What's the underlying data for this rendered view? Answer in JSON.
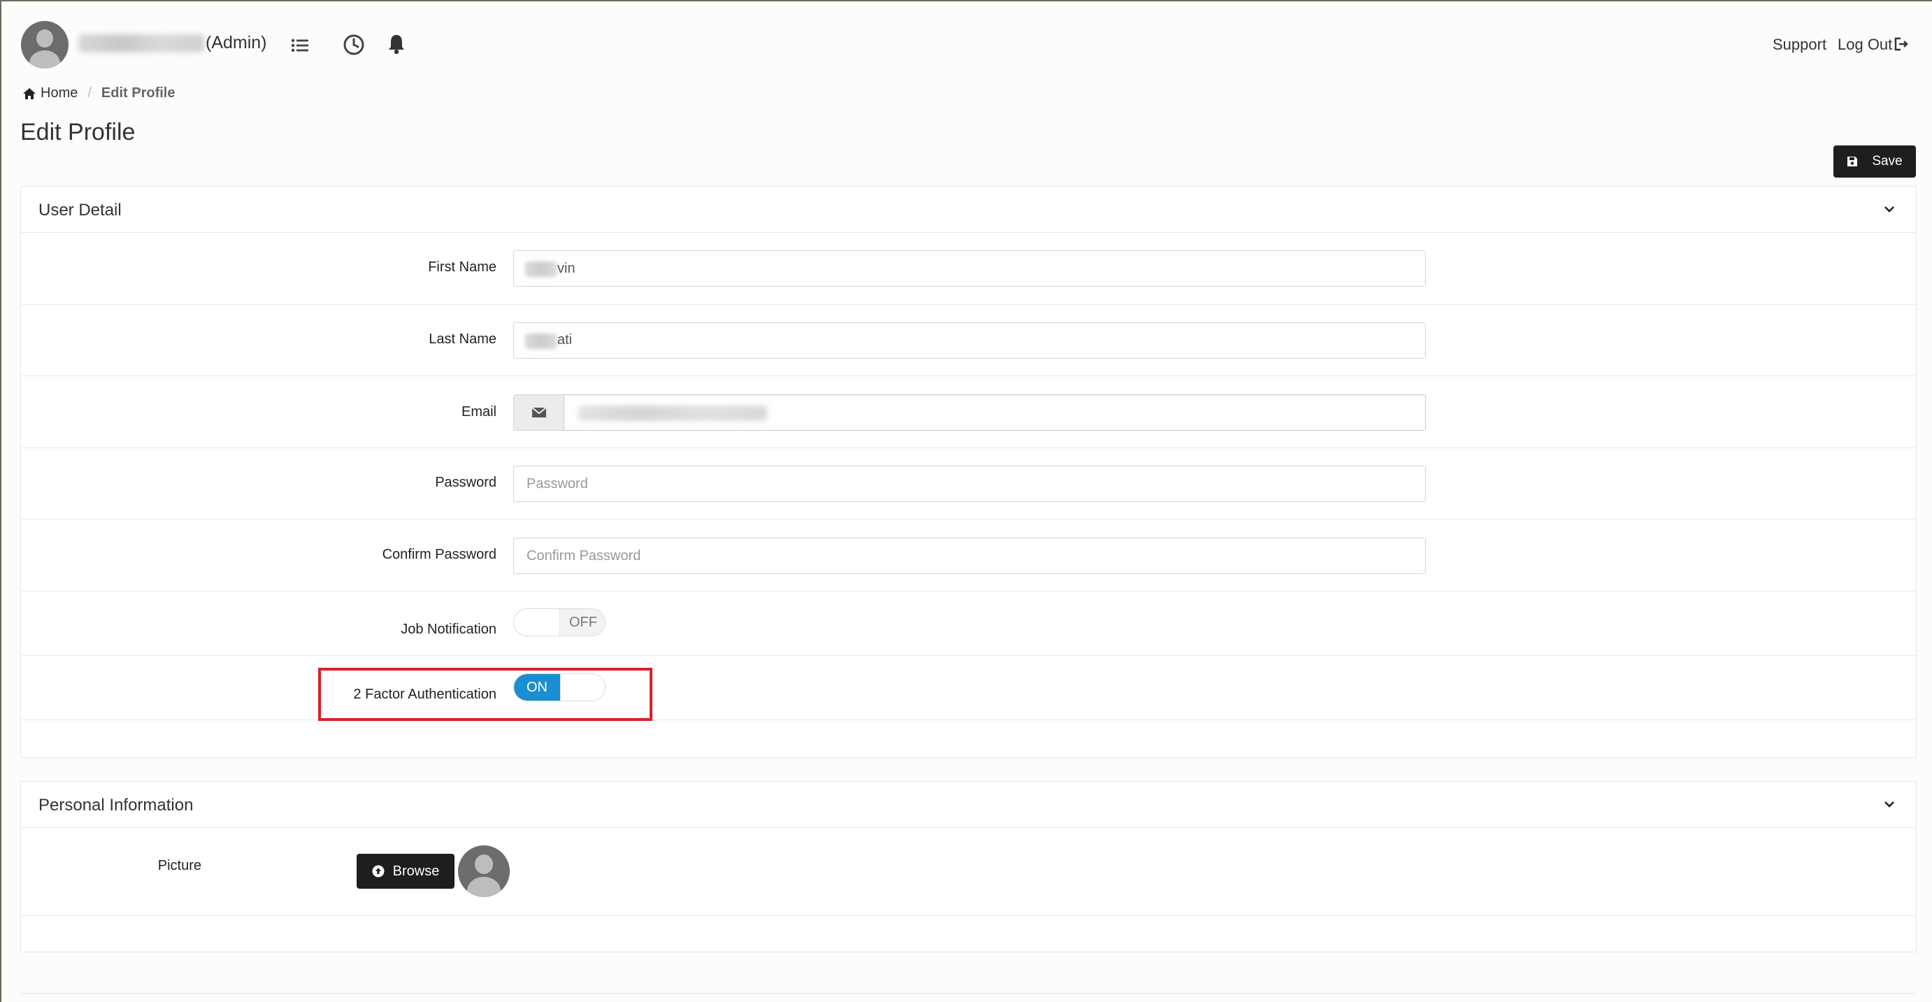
{
  "header": {
    "user_role": "(Admin)",
    "support_label": "Support",
    "logout_label": "Log Out",
    "icons": [
      "list-icon",
      "clock-icon",
      "bell-icon",
      "logout-icon"
    ]
  },
  "breadcrumb": {
    "home": "Home",
    "current": "Edit Profile"
  },
  "page": {
    "title": "Edit Profile",
    "save_label": "Save"
  },
  "user_detail": {
    "title": "User Detail",
    "first_name": {
      "label": "First Name",
      "value_visible": "vin"
    },
    "last_name": {
      "label": "Last Name",
      "value_visible": "ati"
    },
    "email": {
      "label": "Email"
    },
    "password": {
      "label": "Password",
      "placeholder": "Password"
    },
    "confirm_password": {
      "label": "Confirm Password",
      "placeholder": "Confirm Password"
    },
    "job_notification": {
      "label": "Job Notification",
      "state": "OFF"
    },
    "two_factor": {
      "label": "2 Factor Authentication",
      "state": "ON"
    }
  },
  "personal_info": {
    "title": "Personal Information",
    "picture_label": "Picture",
    "browse_label": "Browse"
  },
  "colors": {
    "toggle_on": "#1a8fd0",
    "button_dark": "#1e1e1e",
    "highlight": "#d9202a"
  }
}
